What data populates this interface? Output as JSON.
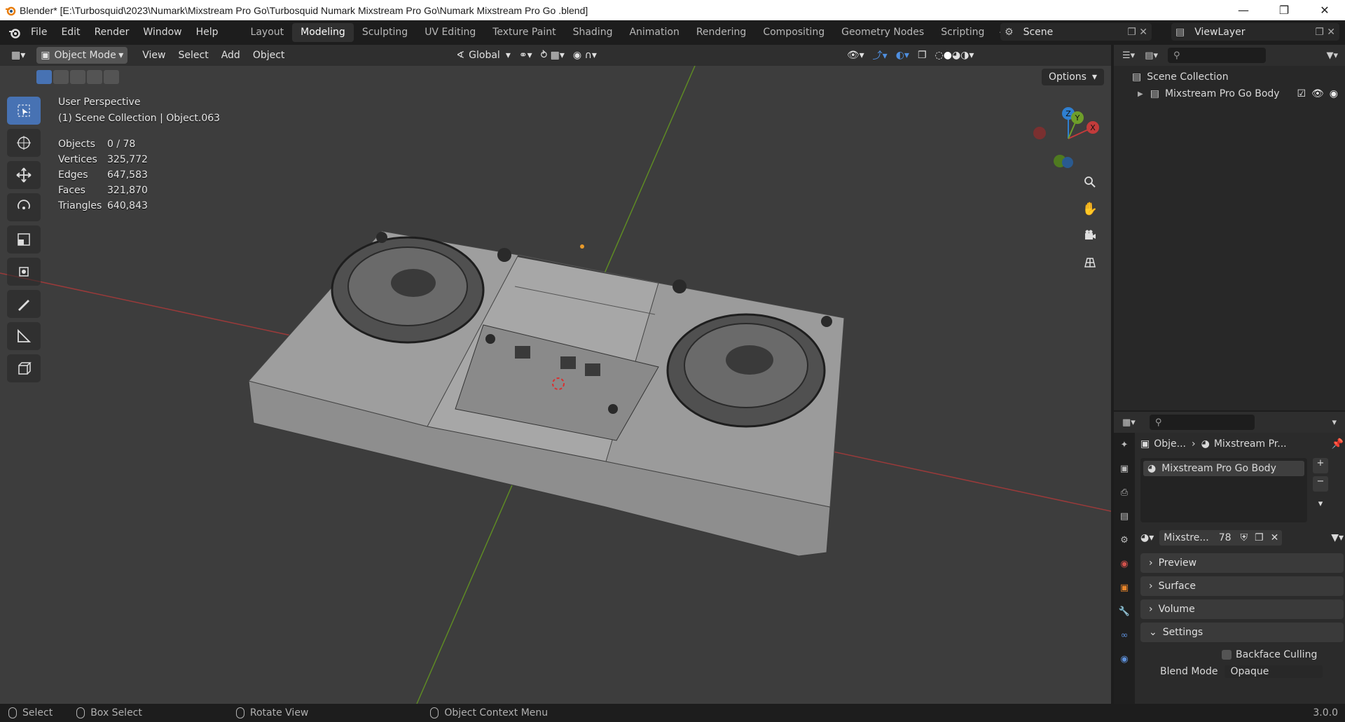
{
  "window": {
    "title": "Blender* [E:\\Turbosquid\\2023\\Numark\\Mixstream Pro Go\\Turbosquid Numark Mixstream Pro Go\\Numark Mixstream Pro Go .blend]",
    "controls": [
      "minimize",
      "restore",
      "close"
    ]
  },
  "menu": {
    "items": [
      "File",
      "Edit",
      "Render",
      "Window",
      "Help"
    ],
    "workspaces": [
      "Layout",
      "Modeling",
      "Sculpting",
      "UV Editing",
      "Texture Paint",
      "Shading",
      "Animation",
      "Rendering",
      "Compositing",
      "Geometry Nodes",
      "Scripting"
    ],
    "active_workspace": "Modeling",
    "scene": "Scene",
    "view_layer": "ViewLayer"
  },
  "viewport": {
    "mode": "Object Mode",
    "menus": [
      "View",
      "Select",
      "Add",
      "Object"
    ],
    "orientation": "Global",
    "options_label": "Options",
    "perspective": "User Perspective",
    "collection_info": "(1) Scene Collection | Object.063",
    "stats": [
      {
        "label": "Objects",
        "value": "0 / 78"
      },
      {
        "label": "Vertices",
        "value": "325,772"
      },
      {
        "label": "Edges",
        "value": "647,583"
      },
      {
        "label": "Faces",
        "value": "321,870"
      },
      {
        "label": "Triangles",
        "value": "640,843"
      }
    ],
    "gizmo_axes": {
      "z": "Z",
      "y": "Y",
      "x": "X"
    },
    "colors": {
      "x_axis": "#c23b3b",
      "y_axis": "#6e9e2a",
      "z_axis": "#2f7fd0",
      "active": "#4772b3"
    }
  },
  "outliner": {
    "root": "Scene Collection",
    "items": [
      {
        "label": "Mixstream Pro Go Body"
      }
    ]
  },
  "properties": {
    "breadcrumb_obj": "Obje...",
    "breadcrumb_mat": "Mixstream Pr...",
    "material_slot": "Mixstream Pro Go Body",
    "material_name": "Mixstre...",
    "user_count": "78",
    "panels": [
      "Preview",
      "Surface",
      "Volume",
      "Settings"
    ],
    "backface_culling": "Backface Culling",
    "blend_mode_label": "Blend Mode",
    "blend_mode_value": "Opaque"
  },
  "status": {
    "items": [
      "Select",
      "Box Select",
      "Rotate View",
      "Object Context Menu"
    ],
    "version": "3.0.0"
  }
}
